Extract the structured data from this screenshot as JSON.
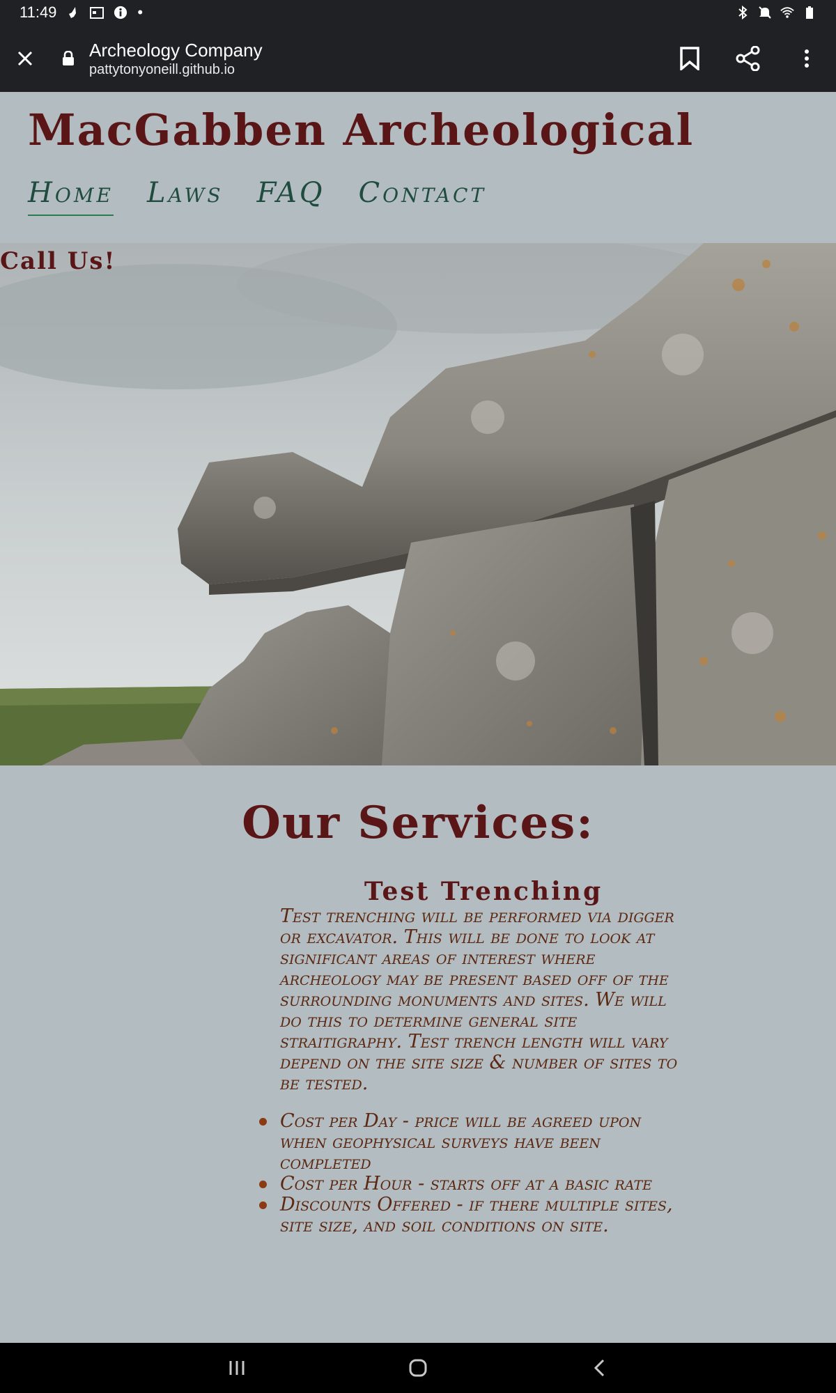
{
  "status_bar": {
    "time": "11:49",
    "dot": "•"
  },
  "browser": {
    "title": "Archeology Company",
    "url": "pattytonyoneill.github.io"
  },
  "site": {
    "title": "MacGabben Archeological",
    "nav": [
      {
        "label": "Home",
        "active": true
      },
      {
        "label": "Laws",
        "active": false
      },
      {
        "label": "FAQ",
        "active": false
      },
      {
        "label": "Contact",
        "active": false
      }
    ],
    "call_us": "Call Us!",
    "services_title": "Our Services:",
    "service": {
      "title": "Test Trenching",
      "description": "Test trenching will be performed via digger or excavator. This will be done to look at significant areas of interest where archeology may be present based off of the surrounding monuments and sites. We will do this to determine general site straitigraphy. Test trench length will vary depend on the site size & number of sites to be tested.",
      "items": [
        "Cost per Day - price will be agreed upon when geophysical surveys have been completed",
        "Cost per Hour - starts off at a basic rate",
        "Discounts Offered - if there multiple sites, site size, and soil conditions on site."
      ]
    }
  },
  "colors": {
    "page_bg": "#b3bcc1",
    "heading": "#5a1616",
    "nav": "#1f4c3e",
    "body_text": "#5b2812",
    "chrome": "#202124"
  }
}
